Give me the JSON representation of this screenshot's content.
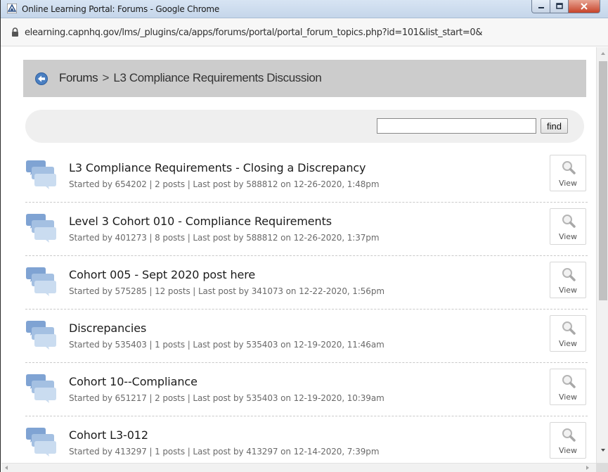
{
  "window": {
    "title": "Online Learning Portal: Forums - Google Chrome",
    "icon": "portal-triangle-icon"
  },
  "address": {
    "url": "elearning.capnhq.gov/lms/_plugins/ca/apps/forums/portal/portal_forum_topics.php?id=101&list_start=0&",
    "icon": "lock-icon"
  },
  "breadcrumb": {
    "root": "Forums",
    "separator": ">",
    "current": "L3 Compliance Requirements Discussion"
  },
  "search": {
    "value": "",
    "button_label": "find"
  },
  "topics": [
    {
      "title": "L3 Compliance Requirements - Closing a Discrepancy",
      "meta": "Started by 654202 | 2 posts | Last post by 588812 on 12-26-2020, 1:48pm",
      "view_label": "View"
    },
    {
      "title": "Level 3 Cohort 010 - Compliance Requirements",
      "meta": "Started by 401273 | 8 posts | Last post by 588812 on 12-26-2020, 1:37pm",
      "view_label": "View"
    },
    {
      "title": "Cohort 005 - Sept 2020 post here",
      "meta": "Started by 575285 | 12 posts | Last post by 341073 on 12-22-2020, 1:56pm",
      "view_label": "View"
    },
    {
      "title": "Discrepancies",
      "meta": "Started by 535403 | 1 posts | Last post by 535403 on 12-19-2020, 11:46am",
      "view_label": "View"
    },
    {
      "title": "Cohort 10--Compliance",
      "meta": "Started by 651217 | 2 posts | Last post by 535403 on 12-19-2020, 10:39am",
      "view_label": "View"
    },
    {
      "title": "Cohort L3-012",
      "meta": "Started by 413297 | 1 posts | Last post by 413297 on 12-14-2020, 7:39pm",
      "view_label": "View"
    }
  ],
  "colors": {
    "breadcrumb_bar": "#cccccc",
    "search_bar": "#efefef",
    "back_arrow": "#4a7fc1",
    "bubble_back": "#8fb0d8",
    "bubble_front": "#c4d6ec"
  }
}
